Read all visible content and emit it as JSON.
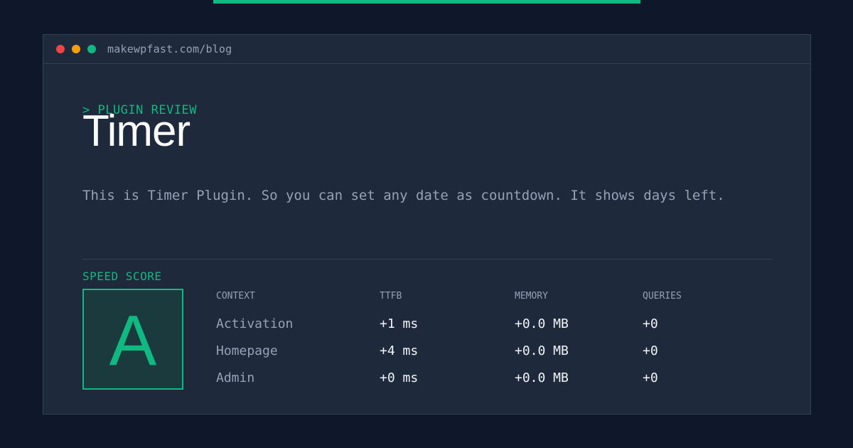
{
  "window": {
    "url": "makewpfast.com/blog"
  },
  "article": {
    "kicker": "> PLUGIN REVIEW",
    "title": "Timer",
    "description": "This is Timer Plugin. So you can set any date as countdown. It shows days left."
  },
  "speed": {
    "label": "SPEED SCORE",
    "grade": "A",
    "headers": [
      "CONTEXT",
      "TTFB",
      "MEMORY",
      "QUERIES"
    ],
    "rows": [
      {
        "context": "Activation",
        "ttfb": "+1 ms",
        "memory": "+0.0 MB",
        "queries": "+0"
      },
      {
        "context": "Homepage",
        "ttfb": "+4 ms",
        "memory": "+0.0 MB",
        "queries": "+0"
      },
      {
        "context": "Admin",
        "ttfb": "+0 ms",
        "memory": "+0.0 MB",
        "queries": "+0"
      }
    ]
  },
  "colors": {
    "accent": "#10b981",
    "background": "#0f172a",
    "panel": "#1e293b",
    "muted_text": "#94a3b8",
    "window_red": "#ef4444",
    "window_yellow": "#f59e0b",
    "window_green": "#10b981"
  }
}
